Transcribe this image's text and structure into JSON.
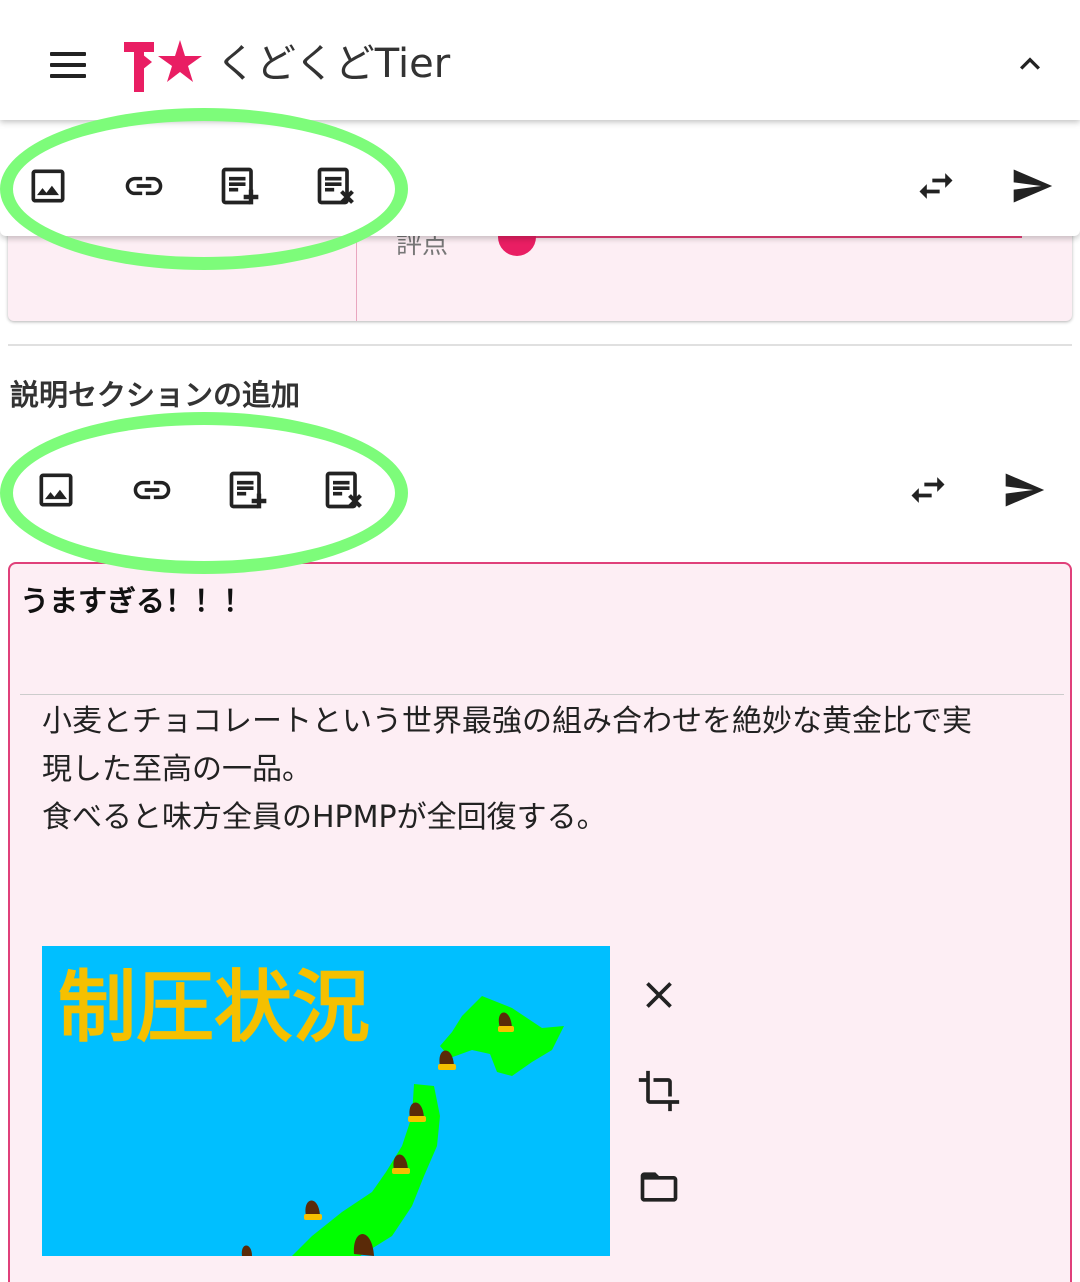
{
  "app": {
    "title": "くどくどTier"
  },
  "icons": {
    "menu": "menu-icon",
    "collapse": "chevron-up-icon",
    "image": "image-icon",
    "link": "link-icon",
    "note_add": "playlist-add-icon",
    "note_remove": "playlist-remove-icon",
    "swap": "swap-horiz-icon",
    "send": "send-icon",
    "close": "close-icon",
    "crop": "crop-icon",
    "folder": "folder-open-icon"
  },
  "card_under": {
    "score_label": "評点"
  },
  "section": {
    "heading": "説明セクションの追加"
  },
  "editor": {
    "title": "うますぎる！！！",
    "body_lines": [
      "小麦とチョコレートという世界最強の組み合わせを絶妙な黄金比で実",
      "現した至高の一品。",
      "食べると味方全員のHPMPが全回復する。"
    ],
    "image_caption": "制圧状況"
  },
  "colors": {
    "accent": "#e91e63",
    "card_bg": "#fdeef4",
    "highlight_ring": "#7dfc7a",
    "map_sea": "#00bfff",
    "map_land": "#00ff00",
    "map_text": "#f5c000"
  }
}
